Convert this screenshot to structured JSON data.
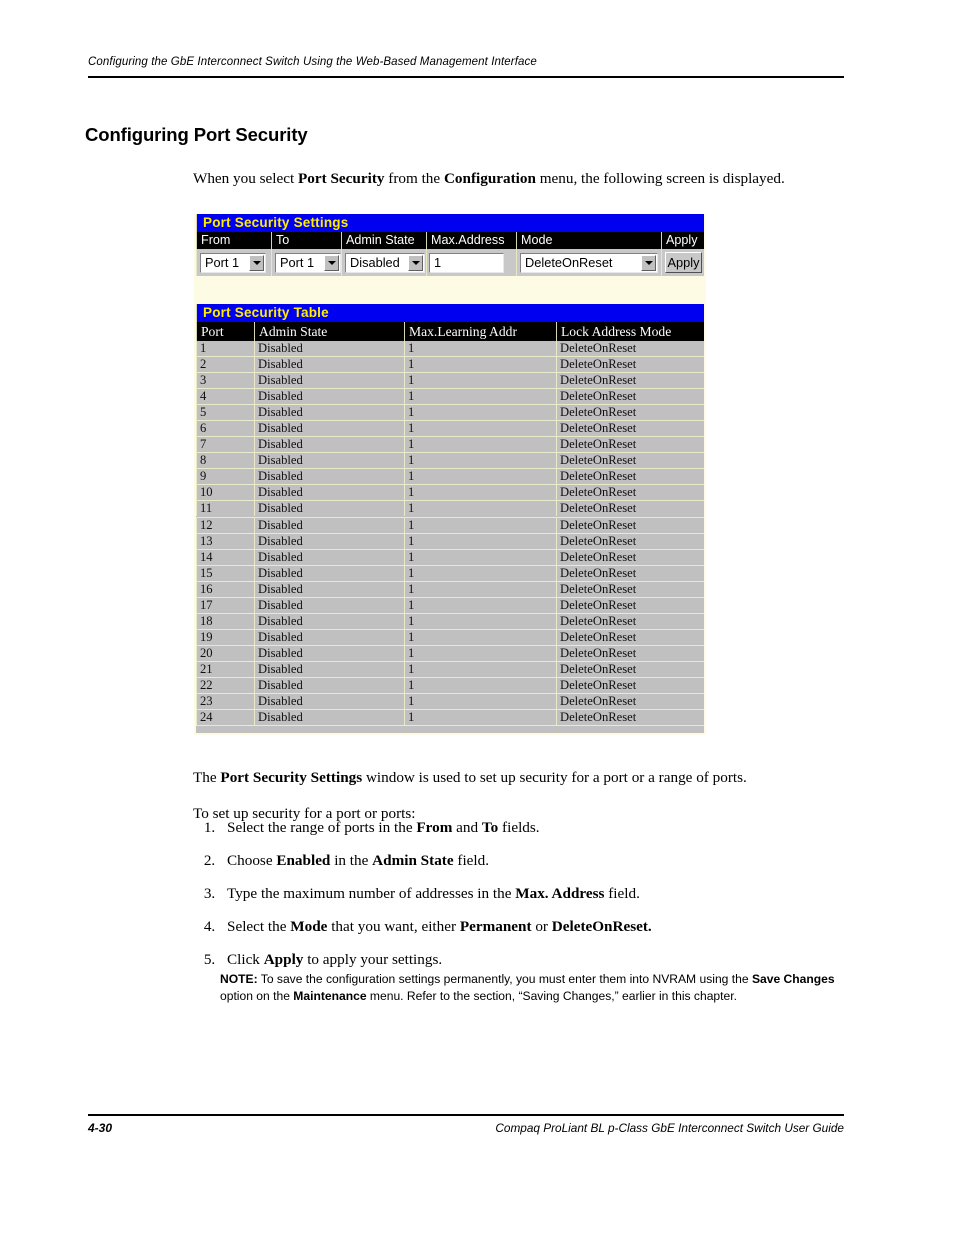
{
  "page": {
    "running_head": "Configuring the GbE Interconnect Switch Using the Web-Based Management Interface",
    "section_title": "Configuring Port Security",
    "folio": "4-30",
    "footer_title": "Compaq ProLiant BL p-Class GbE Interconnect Switch User Guide"
  },
  "body": {
    "intro_pre": "When you select ",
    "intro_b1": "Port Security",
    "intro_mid": " from the ",
    "intro_b2": "Configuration",
    "intro_post": " menu, the following screen is displayed.",
    "para1_pre": "The ",
    "para1_b": "Port Security Settings",
    "para1_post": " window is used to set up security for a port or a range of ports.",
    "para2": "To set up security for a port or ports:",
    "steps": [
      {
        "pre": "Select the range of ports in the ",
        "b1": "From",
        "mid": " and ",
        "b2": "To",
        "post": " fields."
      },
      {
        "pre": "Choose ",
        "b1": "Enabled",
        "mid": " in the ",
        "b2": "Admin State",
        "post": " field."
      },
      {
        "pre": "Type the maximum number of addresses in the ",
        "b1": "Max. Address",
        "mid": "",
        "b2": "",
        "post": " field."
      },
      {
        "pre": "Select the ",
        "b1": "Mode",
        "mid": " that you want, either ",
        "b2": "Permanent",
        "post": " or ",
        "b3": "DeleteOnReset."
      },
      {
        "pre": "Click ",
        "b1": "Apply",
        "mid": "",
        "b2": "",
        "post": " to apply your settings."
      }
    ],
    "note": {
      "label": "NOTE:",
      "t1": "  To save the configuration settings permanently, you must enter them into NVRAM using the ",
      "b1": "Save Changes",
      "t2": " option on the ",
      "b2": "Maintenance",
      "t3": " menu. Refer to the section, “Saving Changes,” earlier in this chapter."
    }
  },
  "screenshot": {
    "settings_panel": {
      "title": "Port Security Settings",
      "headers": [
        "From",
        "To",
        "Admin State",
        "Max.Address",
        "Mode",
        "Apply"
      ],
      "from_value": "Port 1",
      "to_value": "Port 1",
      "admin_state_value": "Disabled",
      "max_address_value": "1",
      "mode_value": "DeleteOnReset",
      "apply_label": "Apply"
    },
    "table_panel": {
      "title": "Port Security Table",
      "headers": [
        "Port",
        "Admin State",
        "Max.Learning Addr",
        "Lock Address Mode"
      ],
      "rows": [
        [
          "1",
          "Disabled",
          "1",
          "DeleteOnReset"
        ],
        [
          "2",
          "Disabled",
          "1",
          "DeleteOnReset"
        ],
        [
          "3",
          "Disabled",
          "1",
          "DeleteOnReset"
        ],
        [
          "4",
          "Disabled",
          "1",
          "DeleteOnReset"
        ],
        [
          "5",
          "Disabled",
          "1",
          "DeleteOnReset"
        ],
        [
          "6",
          "Disabled",
          "1",
          "DeleteOnReset"
        ],
        [
          "7",
          "Disabled",
          "1",
          "DeleteOnReset"
        ],
        [
          "8",
          "Disabled",
          "1",
          "DeleteOnReset"
        ],
        [
          "9",
          "Disabled",
          "1",
          "DeleteOnReset"
        ],
        [
          "10",
          "Disabled",
          "1",
          "DeleteOnReset"
        ],
        [
          "11",
          "Disabled",
          "1",
          "DeleteOnReset"
        ],
        [
          "12",
          "Disabled",
          "1",
          "DeleteOnReset"
        ],
        [
          "13",
          "Disabled",
          "1",
          "DeleteOnReset"
        ],
        [
          "14",
          "Disabled",
          "1",
          "DeleteOnReset"
        ],
        [
          "15",
          "Disabled",
          "1",
          "DeleteOnReset"
        ],
        [
          "16",
          "Disabled",
          "1",
          "DeleteOnReset"
        ],
        [
          "17",
          "Disabled",
          "1",
          "DeleteOnReset"
        ],
        [
          "18",
          "Disabled",
          "1",
          "DeleteOnReset"
        ],
        [
          "19",
          "Disabled",
          "1",
          "DeleteOnReset"
        ],
        [
          "20",
          "Disabled",
          "1",
          "DeleteOnReset"
        ],
        [
          "21",
          "Disabled",
          "1",
          "DeleteOnReset"
        ],
        [
          "22",
          "Disabled",
          "1",
          "DeleteOnReset"
        ],
        [
          "23",
          "Disabled",
          "1",
          "DeleteOnReset"
        ],
        [
          "24",
          "Disabled",
          "1",
          "DeleteOnReset"
        ]
      ]
    },
    "colors": {
      "title_bar_bg": "#0000f0",
      "title_bar_fg": "#ffee00",
      "header_bg": "#000000",
      "header_fg": "#ffffff",
      "row_bg": "#c0c0c0",
      "page_bg": "#fdfbe4"
    }
  }
}
